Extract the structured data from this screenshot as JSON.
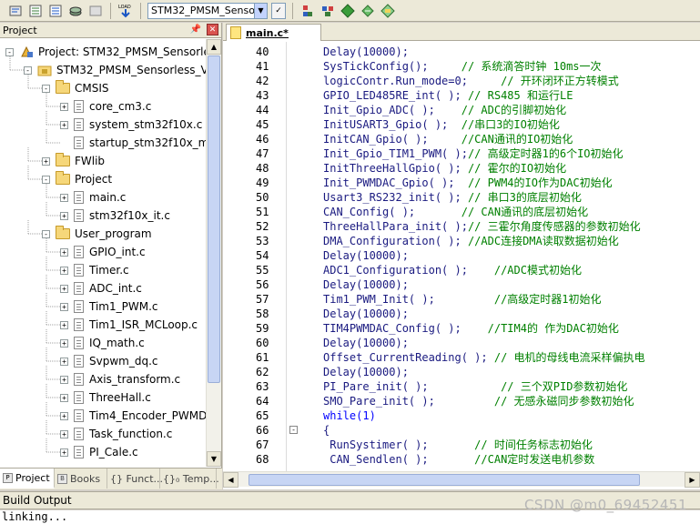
{
  "toolbar": {
    "target_name": "STM32_PMSM_Sensorles:",
    "load_label": "LOAD"
  },
  "project_panel": {
    "title": "Project",
    "tree": [
      {
        "label": "Project: STM32_PMSM_Sensorless_",
        "level": 0,
        "kind": "project",
        "expander": "-"
      },
      {
        "label": "STM32_PMSM_Sensorless_V17_",
        "level": 1,
        "kind": "target",
        "expander": "-"
      },
      {
        "label": "CMSIS",
        "level": 2,
        "kind": "folder",
        "expander": "-"
      },
      {
        "label": "core_cm3.c",
        "level": 3,
        "kind": "file",
        "expander": "+"
      },
      {
        "label": "system_stm32f10x.c",
        "level": 3,
        "kind": "file",
        "expander": "+"
      },
      {
        "label": "startup_stm32f10x_md.",
        "level": 3,
        "kind": "file",
        "expander": ""
      },
      {
        "label": "FWlib",
        "level": 2,
        "kind": "folder",
        "expander": "+"
      },
      {
        "label": "Project",
        "level": 2,
        "kind": "folder",
        "expander": "-"
      },
      {
        "label": "main.c",
        "level": 3,
        "kind": "file",
        "expander": "+"
      },
      {
        "label": "stm32f10x_it.c",
        "level": 3,
        "kind": "file",
        "expander": "+"
      },
      {
        "label": "User_program",
        "level": 2,
        "kind": "folder",
        "expander": "-"
      },
      {
        "label": "GPIO_int.c",
        "level": 3,
        "kind": "file",
        "expander": "+"
      },
      {
        "label": "Timer.c",
        "level": 3,
        "kind": "file",
        "expander": "+"
      },
      {
        "label": "ADC_int.c",
        "level": 3,
        "kind": "file",
        "expander": "+"
      },
      {
        "label": "Tim1_PWM.c",
        "level": 3,
        "kind": "file",
        "expander": "+"
      },
      {
        "label": "Tim1_ISR_MCLoop.c",
        "level": 3,
        "kind": "file",
        "expander": "+"
      },
      {
        "label": "IQ_math.c",
        "level": 3,
        "kind": "file",
        "expander": "+"
      },
      {
        "label": "Svpwm_dq.c",
        "level": 3,
        "kind": "file",
        "expander": "+"
      },
      {
        "label": "Axis_transform.c",
        "level": 3,
        "kind": "file",
        "expander": "+"
      },
      {
        "label": "ThreeHall.c",
        "level": 3,
        "kind": "file",
        "expander": "+"
      },
      {
        "label": "Tim4_Encoder_PWMDA",
        "level": 3,
        "kind": "file",
        "expander": "+"
      },
      {
        "label": "Task_function.c",
        "level": 3,
        "kind": "file",
        "expander": "+"
      },
      {
        "label": "PI_Cale.c",
        "level": 3,
        "kind": "file",
        "expander": "+"
      }
    ],
    "tabs": [
      {
        "label": "Project",
        "icon": "P"
      },
      {
        "label": "Books",
        "icon": "B"
      },
      {
        "label": "{} Funct...",
        "icon": ""
      },
      {
        "label": "{}₀ Temp...",
        "icon": ""
      }
    ]
  },
  "editor": {
    "tab_label": "main.c*",
    "lines": [
      {
        "n": "40",
        "code": "Delay(10000);",
        "comment": ""
      },
      {
        "n": "41",
        "code": "SysTickConfig();     ",
        "comment": "// 系统滴答时钟 10ms一次"
      },
      {
        "n": "42",
        "code": "logicContr.Run_mode=0;     ",
        "comment": "// 开环闭环正方转模式"
      },
      {
        "n": "43",
        "code": "GPIO_LED485RE_int( ); ",
        "comment": "// RS485 和运行LE"
      },
      {
        "n": "44",
        "code": "Init_Gpio_ADC( );    ",
        "comment": "// ADC的引脚初始化"
      },
      {
        "n": "45",
        "code": "InitUSART3_Gpio( );  ",
        "comment": "//串口3的IO初始化"
      },
      {
        "n": "46",
        "code": "InitCAN_Gpio( );     ",
        "comment": "//CAN通讯的IO初始化"
      },
      {
        "n": "47",
        "code": "Init_Gpio_TIM1_PWM( );",
        "comment": "// 高级定时器1的6个IO初始化"
      },
      {
        "n": "48",
        "code": "InitThreeHallGpio( ); ",
        "comment": "// 霍尔的IO初始化"
      },
      {
        "n": "49",
        "code": "Init_PWMDAC_Gpio( );  ",
        "comment": "// PWM4的IO作为DAC初始化"
      },
      {
        "n": "50",
        "code": "Usart3_RS232_init( ); ",
        "comment": "// 串口3的底层初始化"
      },
      {
        "n": "51",
        "code": "CAN_Config( );       ",
        "comment": "// CAN通讯的底层初始化"
      },
      {
        "n": "52",
        "code": "ThreeHallPara_init( );",
        "comment": "// 三霍尔角度传感器的参数初始化"
      },
      {
        "n": "53",
        "code": "DMA_Configuration( ); ",
        "comment": "//ADC连接DMA读取数据初始化"
      },
      {
        "n": "54",
        "code": "Delay(10000);",
        "comment": ""
      },
      {
        "n": "55",
        "code": "ADC1_Configuration( );    ",
        "comment": "//ADC模式初始化"
      },
      {
        "n": "56",
        "code": "Delay(10000);",
        "comment": ""
      },
      {
        "n": "57",
        "code": "Tim1_PWM_Init( );         ",
        "comment": "//高级定时器1初始化"
      },
      {
        "n": "58",
        "code": "Delay(10000);",
        "comment": ""
      },
      {
        "n": "59",
        "code": "TIM4PWMDAC_Config( );    ",
        "comment": "//TIM4的 作为DAC初始化"
      },
      {
        "n": "60",
        "code": "Delay(10000);",
        "comment": ""
      },
      {
        "n": "61",
        "code": "Offset_CurrentReading( ); ",
        "comment": "// 电机的母线电流采样偏执电"
      },
      {
        "n": "62",
        "code": "Delay(10000);",
        "comment": ""
      },
      {
        "n": "63",
        "code": "PI_Pare_init( );           ",
        "comment": "// 三个双PID参数初始化"
      },
      {
        "n": "64",
        "code": "SMO_Pare_init( );         ",
        "comment": "// 无感永磁同步参数初始化"
      },
      {
        "n": "65",
        "code": "while(1)",
        "comment": "",
        "keyword": true
      },
      {
        "n": "66",
        "code": "{",
        "comment": "",
        "fold": true
      },
      {
        "n": "67",
        "code": " RunSystimer( );       ",
        "comment": "// 时间任务标志初始化"
      },
      {
        "n": "68",
        "code": " CAN_Sendlen( );       ",
        "comment": "//CAN定时发送电机参数"
      }
    ]
  },
  "build_output": {
    "title": "Build Output",
    "text": "linking..."
  },
  "watermark": "CSDN @m0_69452451"
}
